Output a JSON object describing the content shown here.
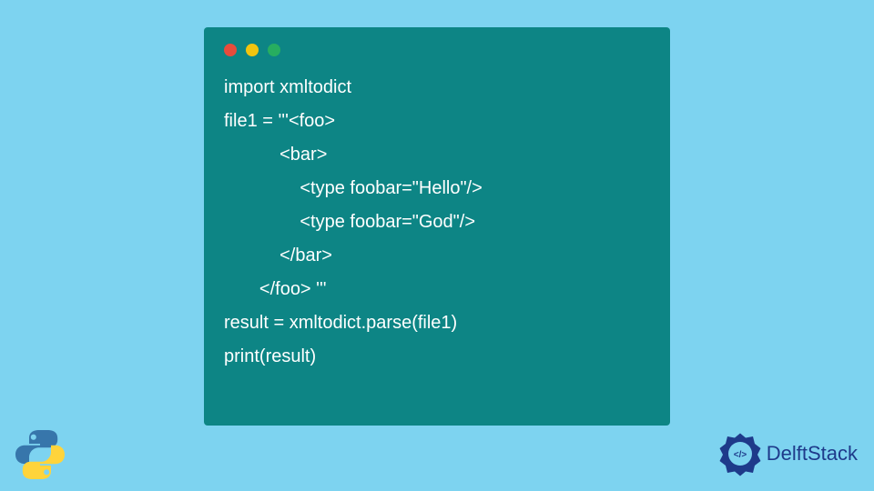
{
  "code": {
    "line1": "import xmltodict",
    "line2": "file1 = '''<foo>",
    "line3": "           <bar>",
    "line4": "               <type foobar=\"Hello\"/>",
    "line5": "               <type foobar=\"God\"/>",
    "line6": "           </bar>",
    "line7": "       </foo> '''",
    "line8": "result = xmltodict.parse(file1)",
    "line9": "print(result)"
  },
  "branding": {
    "name": "DelftStack"
  }
}
